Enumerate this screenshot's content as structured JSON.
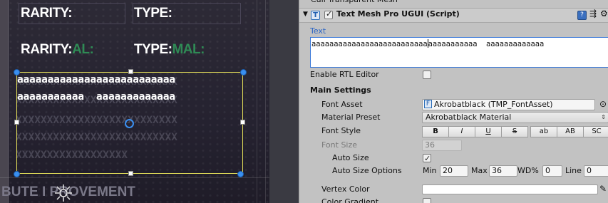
{
  "scene": {
    "stat_rows": [
      {
        "label": "RARITY:",
        "suffix": "",
        "label2": "TYPE:",
        "suffix2": ""
      },
      {
        "label": "RARITY:",
        "suffix": "AL:",
        "label2": "TYPE:",
        "suffix2": "MAL:"
      }
    ],
    "text_line_1": "aaaaaaaaaaaaaaaaaaaaaaaaaa",
    "text_line_2": "aaaaaaaaaaa  aaaaaaaaaaaaa",
    "ghost_lines": [
      "XXXXXXXXXXXXXXXXXXXXXXXXXX",
      "XXXXXXXXXXXXXXXXXXXXXXXXXX",
      "XXXXXXXXXXXXXXXXXXXXXXXXXX",
      "XXXXXXXXXXXXXXXXXXXXXXXXXX",
      "XXXXXXXXXXXXXXXXXX"
    ],
    "bottom_title": "BUTE I  PROVEMENT"
  },
  "inspector": {
    "cull_label": "Cull Transparent Mesh",
    "component_title": "Text Mesh Pro UGUI (Script)",
    "component_enabled": true,
    "text_label": "Text",
    "text_value_before_caret": "aaaaaaaaaaaaaaaaaaaaaaaaaa",
    "text_value_after_caret": "aaaaaaaaaaa  aaaaaaaaaaaaa",
    "enable_rtl_label": "Enable RTL Editor",
    "enable_rtl": false,
    "main_settings_label": "Main Settings",
    "font_asset_label": "Font Asset",
    "font_asset_value": "Akrobatblack (TMP_FontAsset)",
    "material_preset_label": "Material Preset",
    "material_preset_value": "Akrobatblack Material",
    "font_style_label": "Font Style",
    "font_style_buttons": [
      "B",
      "I",
      "U",
      "S",
      "ab",
      "AB",
      "SC"
    ],
    "font_size_label": "Font Size",
    "font_size_value": "36",
    "auto_size_label": "Auto Size",
    "auto_size": true,
    "auto_size_options_label": "Auto Size Options",
    "min_label": "Min",
    "min_value": "20",
    "max_label": "Max",
    "max_value": "36",
    "wd_label": "WD%",
    "wd_value": "0",
    "line_label": "Line",
    "line_value": "0",
    "vertex_color_label": "Vertex Color",
    "vertex_color": "#ffffff",
    "color_gradient_label": "Color Gradient",
    "color_gradient": false
  },
  "colors": {
    "selection_outline": "#e6e15a",
    "handle_blue": "#3a8ff0",
    "accent_green": "#2f8a55",
    "textarea_border": "#3a78d8"
  }
}
